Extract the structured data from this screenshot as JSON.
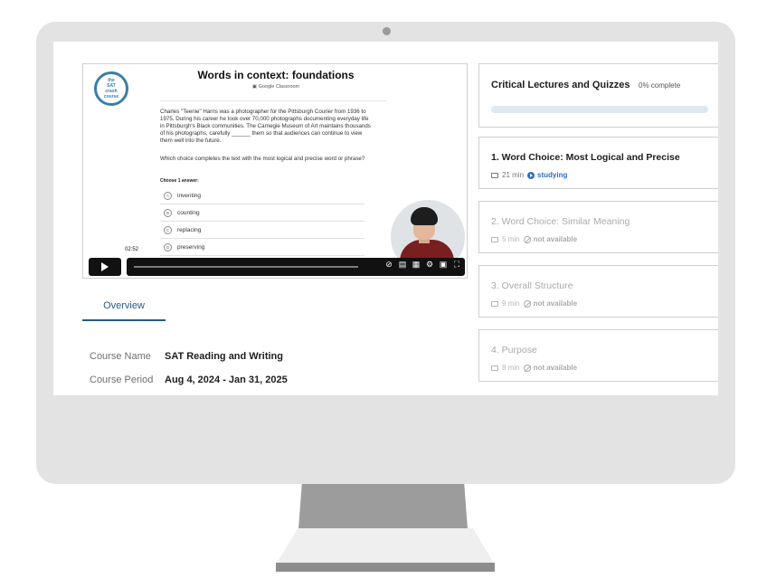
{
  "video": {
    "title": "Words in context: foundations",
    "classroom_label": "Google Classroom",
    "logo_lines": [
      "the",
      "SAT",
      "crash",
      "course"
    ],
    "passage": "Charles \"Teenie\" Harris was a photographer for the Pittsburgh Courier from 1936 to 1975. During his career he took over 70,000 photographs documenting everyday life in Pittsburgh's Black communities. The Carnegie Museum of Art maintains thousands of his photographs, carefully ______ them so that audiences can continue to view them well into the future.",
    "question": "Which choice completes the text with the most logical and precise word or phrase?",
    "choose_label": "Choose 1 answer:",
    "options": [
      {
        "letter": "A",
        "text": "inventing"
      },
      {
        "letter": "B",
        "text": "counting"
      },
      {
        "letter": "C",
        "text": "replacing"
      },
      {
        "letter": "D",
        "text": "preserving"
      }
    ],
    "current_time": "02:52"
  },
  "overview": {
    "tab_label": "Overview",
    "course_name_label": "Course Name",
    "course_name_value": "SAT Reading and Writing",
    "course_period_label": "Course Period",
    "course_period_value": "Aug 4, 2024 - Jan 31, 2025"
  },
  "panel": {
    "title": "Critical Lectures and Quizzes",
    "progress_text": "0% complete",
    "progress_percent": 0,
    "lessons": [
      {
        "title": "1. Word Choice: Most Logical and Precise",
        "duration": "21 min",
        "status": "studying"
      },
      {
        "title": "2. Word Choice: Similar Meaning",
        "duration": "5 min",
        "status": "not available"
      },
      {
        "title": "3. Overall Structure",
        "duration": "9 min",
        "status": "not available"
      },
      {
        "title": "4. Purpose",
        "duration": "8 min",
        "status": "not available"
      }
    ]
  },
  "colors": {
    "accent": "#2b5a7f",
    "studying": "#2f6fc0",
    "progress_track": "#dde8f1"
  }
}
